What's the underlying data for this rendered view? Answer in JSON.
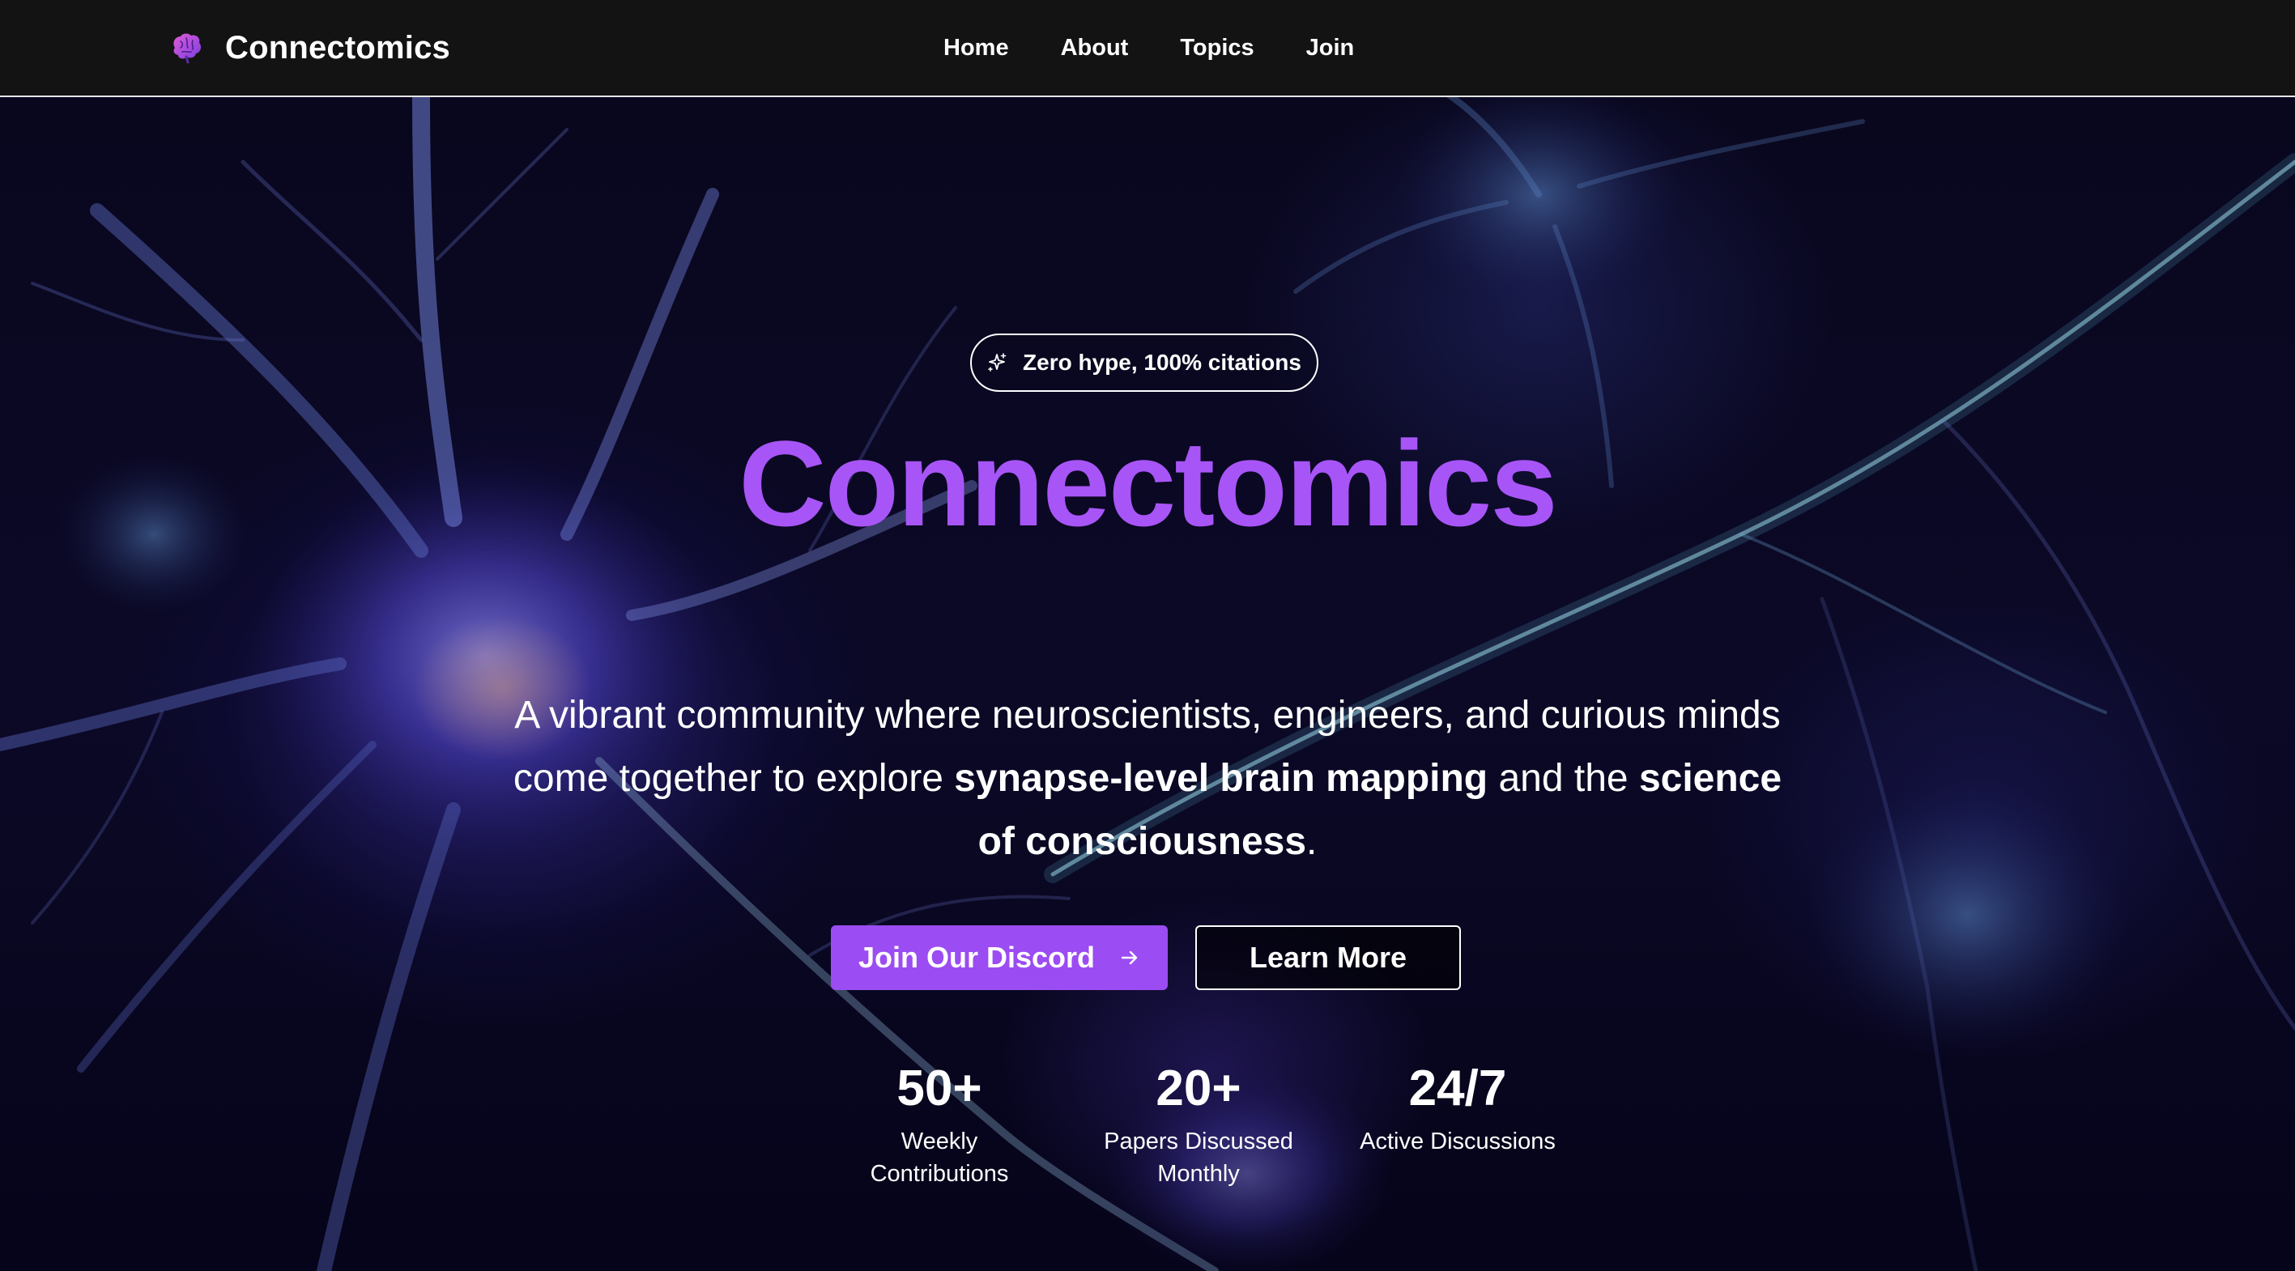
{
  "nav": {
    "brand": "Connectomics",
    "brand_icon": "brain-icon",
    "links": [
      {
        "label": "Home"
      },
      {
        "label": "About"
      },
      {
        "label": "Topics"
      },
      {
        "label": "Join"
      }
    ]
  },
  "hero": {
    "badge": {
      "icon": "sparkles-icon",
      "text": "Zero hype, 100% citations"
    },
    "title": "Connectomics",
    "description": {
      "part1": "A vibrant community where neuroscientists, engineers, and curious minds come together to explore ",
      "bold1": "synapse-level brain mapping",
      "part2": " and the ",
      "bold2": "science of consciousness",
      "part3": "."
    },
    "primary_cta": {
      "label": "Join Our Discord",
      "icon": "arrow-right-icon"
    },
    "secondary_cta": {
      "label": "Learn More"
    },
    "stats": [
      {
        "value": "50+",
        "label": "Weekly Contributions"
      },
      {
        "value": "20+",
        "label": "Papers Discussed Monthly"
      },
      {
        "value": "24/7",
        "label": "Active Discussions"
      }
    ]
  },
  "colors": {
    "accent": "#a855f7",
    "button": "#9b4cf2",
    "navbar_bg": "#131313",
    "hero_bg": "#0b0926"
  }
}
